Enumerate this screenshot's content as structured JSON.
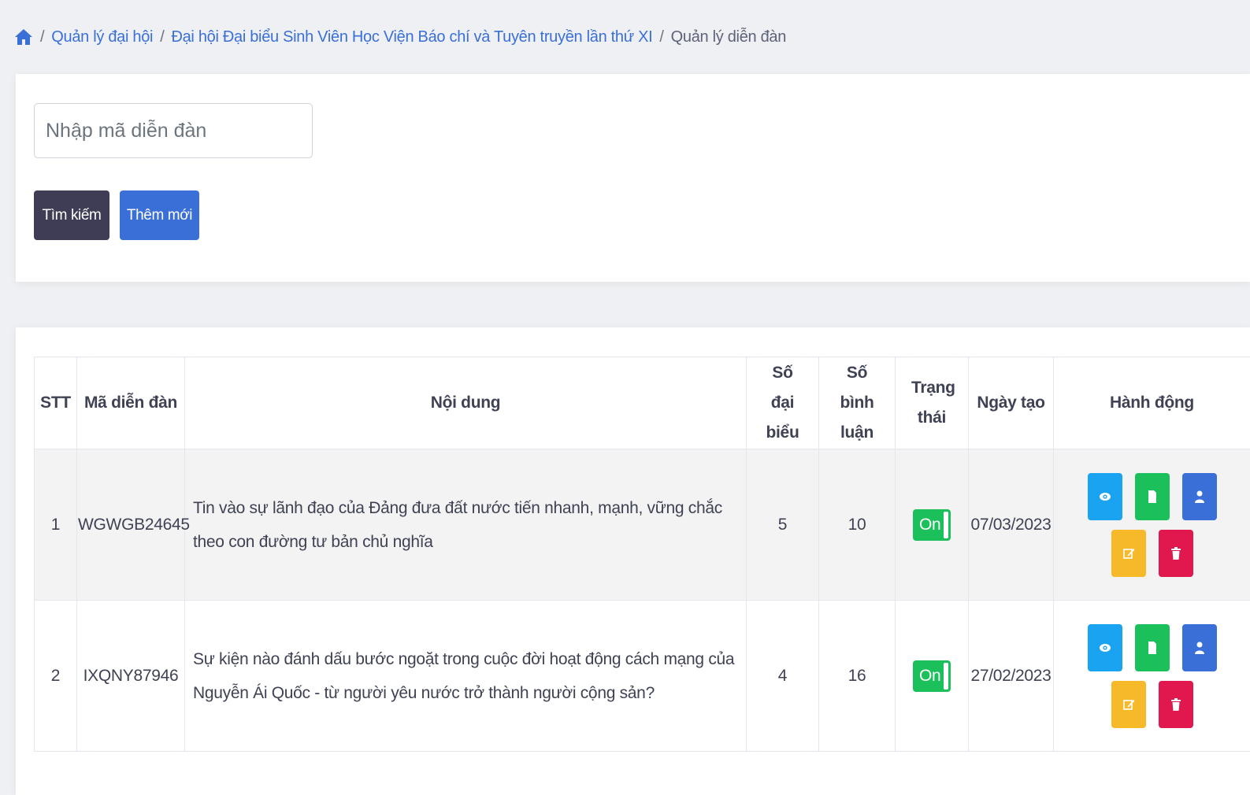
{
  "breadcrumb": {
    "items": [
      "Quản lý đại hội",
      "Đại hội Đại biểu Sinh Viên Học Viện Báo chí và Tuyên truyền lần thứ XI"
    ],
    "current": "Quản lý diễn đàn",
    "separator": "/"
  },
  "search": {
    "placeholder": "Nhập mã diễn đàn",
    "value": "",
    "search_label": "Tìm kiếm",
    "add_label": "Thêm mới"
  },
  "table": {
    "headers": {
      "stt": "STT",
      "code": "Mã diễn đàn",
      "content": "Nội dung",
      "delegates": "Số đại biểu",
      "comments": "Số bình luận",
      "status": "Trạng thái",
      "created": "Ngày tạo",
      "actions": "Hành động"
    },
    "rows": [
      {
        "stt": "1",
        "code": "WGWGB24645",
        "content": "Tin vào sự lãnh đạo của Đảng đưa đất nước tiến nhanh, mạnh, vững chắc theo con đường tư bản chủ nghĩa",
        "delegates": "5",
        "comments": "10",
        "status": "On",
        "created": "07/03/2023"
      },
      {
        "stt": "2",
        "code": "IXQNY87946",
        "content": "Sự kiện nào đánh dấu bước ngoặt trong cuộc đời hoạt động cách mạng của Nguyễn Ái Quốc - từ người yêu nước trở thành người cộng sản?",
        "delegates": "4",
        "comments": "16",
        "status": "On",
        "created": "27/02/2023"
      }
    ],
    "action_icons": [
      "eye-icon",
      "file-icon",
      "user-icon",
      "edit-icon",
      "trash-icon"
    ]
  },
  "colors": {
    "primary": "#3b6fd8",
    "dark": "#3f3d56",
    "info": "#1aa3f0",
    "success": "#1bc05a",
    "warning": "#f5b92a",
    "danger": "#e0184e"
  }
}
